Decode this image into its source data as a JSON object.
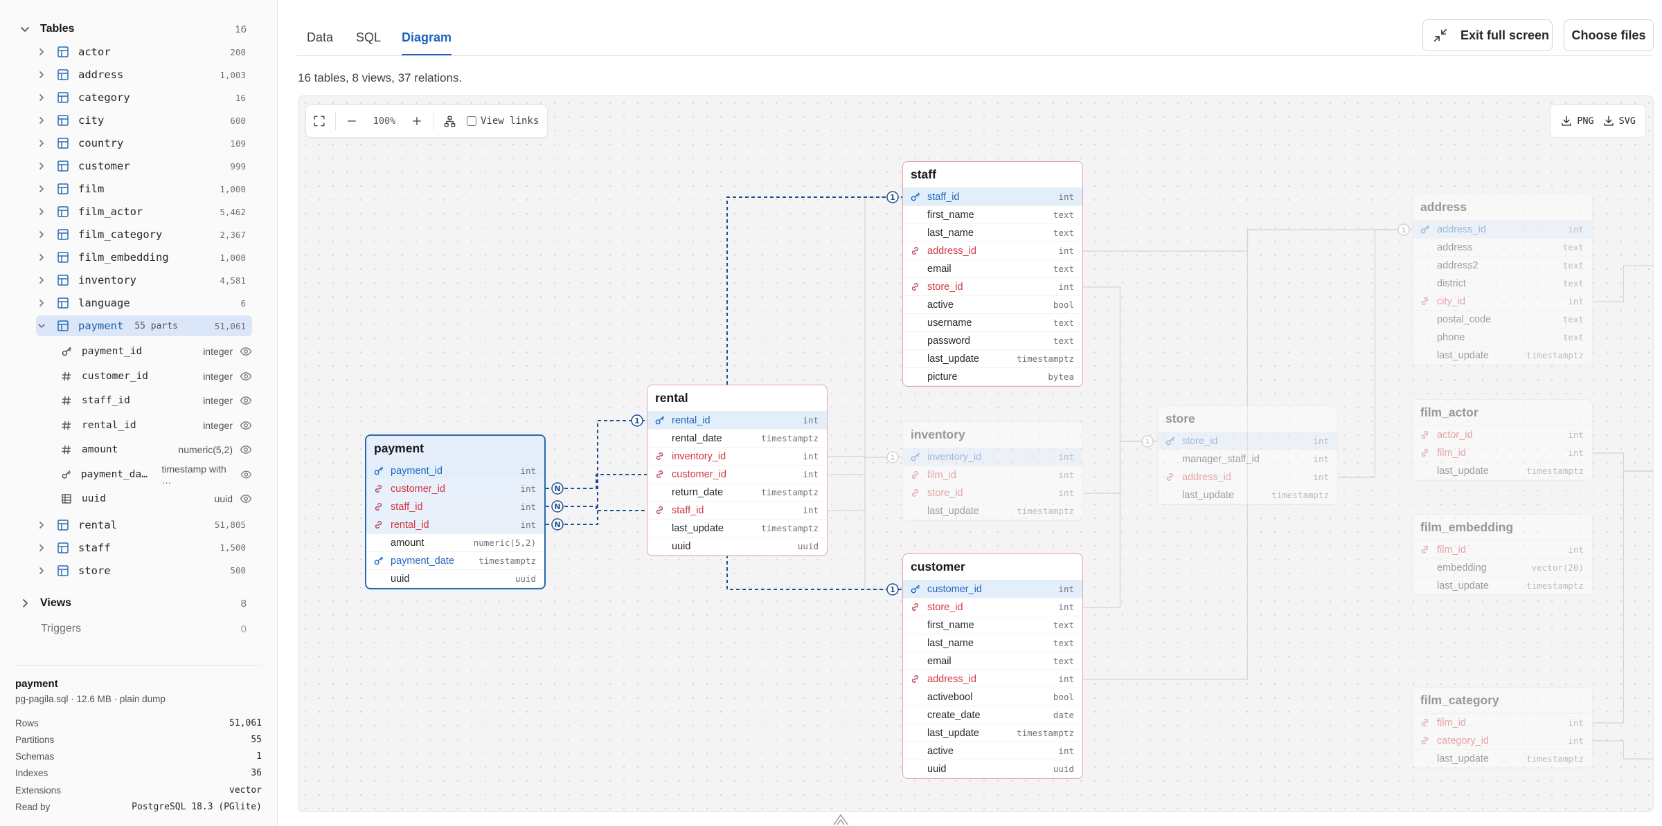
{
  "sidebar": {
    "tables_header": {
      "label": "Tables",
      "count": "16"
    },
    "tables": [
      {
        "name": "actor",
        "count": "200"
      },
      {
        "name": "address",
        "count": "1,003"
      },
      {
        "name": "category",
        "count": "16"
      },
      {
        "name": "city",
        "count": "600"
      },
      {
        "name": "country",
        "count": "109"
      },
      {
        "name": "customer",
        "count": "999"
      },
      {
        "name": "film",
        "count": "1,000"
      },
      {
        "name": "film_actor",
        "count": "5,462"
      },
      {
        "name": "film_category",
        "count": "2,367"
      },
      {
        "name": "film_embedding",
        "count": "1,000"
      },
      {
        "name": "inventory",
        "count": "4,581"
      },
      {
        "name": "language",
        "count": "6"
      },
      {
        "name": "payment",
        "parts": "55 parts",
        "count": "51,061"
      },
      {
        "name": "rental",
        "count": "51,805"
      },
      {
        "name": "staff",
        "count": "1,500"
      },
      {
        "name": "store",
        "count": "500"
      }
    ],
    "payment_columns": [
      {
        "name": "payment_id",
        "type": "integer",
        "icon": "key-icon"
      },
      {
        "name": "customer_id",
        "type": "integer",
        "icon": "hash-icon"
      },
      {
        "name": "staff_id",
        "type": "integer",
        "icon": "hash-icon"
      },
      {
        "name": "rental_id",
        "type": "integer",
        "icon": "hash-icon"
      },
      {
        "name": "amount",
        "type": "numeric(5,2)",
        "icon": "hash-icon"
      },
      {
        "name": "payment_da…",
        "type": "timestamp with …",
        "icon": "key-icon"
      },
      {
        "name": "uuid",
        "type": "uuid",
        "icon": "grid-icon"
      }
    ],
    "views_header": {
      "label": "Views",
      "count": "8"
    },
    "triggers_header": {
      "label": "Triggers",
      "count": "0"
    },
    "info": {
      "title": "payment",
      "subtitle": "pg-pagila.sql · 12.6 MB · plain dump",
      "stats": [
        {
          "label": "Rows",
          "value": "51,061"
        },
        {
          "label": "Partitions",
          "value": "55"
        },
        {
          "label": "Schemas",
          "value": "1"
        },
        {
          "label": "Indexes",
          "value": "36"
        },
        {
          "label": "Extensions",
          "value": "vector"
        },
        {
          "label": "Read by",
          "value": "PostgreSQL 18.3 (PGlite)"
        }
      ]
    }
  },
  "tabs": [
    "Data",
    "SQL",
    "Diagram"
  ],
  "active_tab": "Diagram",
  "buttons": {
    "exit_fullscreen": "Exit full screen",
    "choose_files": "Choose files"
  },
  "summary": "16 tables, 8 views, 37 relations.",
  "toolbar": {
    "zoom": "100%",
    "view_links": "View links",
    "png": "PNG",
    "svg": "SVG"
  },
  "colors": {
    "accent": "#1d63b8",
    "fk": "#d2353f",
    "entity_border": "#e3a3ad"
  },
  "entities": {
    "payment": {
      "title": "payment",
      "rows": [
        {
          "name": "payment_id",
          "type": "int"
        },
        {
          "name": "customer_id",
          "type": "int"
        },
        {
          "name": "staff_id",
          "type": "int"
        },
        {
          "name": "rental_id",
          "type": "int"
        },
        {
          "name": "amount",
          "type": "numeric(5,2)"
        },
        {
          "name": "payment_date",
          "type": "timestamptz"
        },
        {
          "name": "uuid",
          "type": "uuid"
        }
      ]
    },
    "rental": {
      "title": "rental",
      "rows": [
        {
          "name": "rental_id",
          "type": "int"
        },
        {
          "name": "rental_date",
          "type": "timestamptz"
        },
        {
          "name": "inventory_id",
          "type": "int"
        },
        {
          "name": "customer_id",
          "type": "int"
        },
        {
          "name": "return_date",
          "type": "timestamptz"
        },
        {
          "name": "staff_id",
          "type": "int"
        },
        {
          "name": "last_update",
          "type": "timestamptz"
        },
        {
          "name": "uuid",
          "type": "uuid"
        }
      ]
    },
    "staff": {
      "title": "staff",
      "rows": [
        {
          "name": "staff_id",
          "type": "int"
        },
        {
          "name": "first_name",
          "type": "text"
        },
        {
          "name": "last_name",
          "type": "text"
        },
        {
          "name": "address_id",
          "type": "int"
        },
        {
          "name": "email",
          "type": "text"
        },
        {
          "name": "store_id",
          "type": "int"
        },
        {
          "name": "active",
          "type": "bool"
        },
        {
          "name": "username",
          "type": "text"
        },
        {
          "name": "password",
          "type": "text"
        },
        {
          "name": "last_update",
          "type": "timestamptz"
        },
        {
          "name": "picture",
          "type": "bytea"
        }
      ]
    },
    "inventory": {
      "title": "inventory",
      "rows": [
        {
          "name": "inventory_id",
          "type": "int"
        },
        {
          "name": "film_id",
          "type": "int"
        },
        {
          "name": "store_id",
          "type": "int"
        },
        {
          "name": "last_update",
          "type": "timestamptz"
        }
      ]
    },
    "customer": {
      "title": "customer",
      "rows": [
        {
          "name": "customer_id",
          "type": "int"
        },
        {
          "name": "store_id",
          "type": "int"
        },
        {
          "name": "first_name",
          "type": "text"
        },
        {
          "name": "last_name",
          "type": "text"
        },
        {
          "name": "email",
          "type": "text"
        },
        {
          "name": "address_id",
          "type": "int"
        },
        {
          "name": "activebool",
          "type": "bool"
        },
        {
          "name": "create_date",
          "type": "date"
        },
        {
          "name": "last_update",
          "type": "timestamptz"
        },
        {
          "name": "active",
          "type": "int"
        },
        {
          "name": "uuid",
          "type": "uuid"
        }
      ]
    },
    "store": {
      "title": "store",
      "rows": [
        {
          "name": "store_id",
          "type": "int"
        },
        {
          "name": "manager_staff_id",
          "type": "int"
        },
        {
          "name": "address_id",
          "type": "int"
        },
        {
          "name": "last_update",
          "type": "timestamptz"
        }
      ]
    },
    "address": {
      "title": "address",
      "rows": [
        {
          "name": "address_id",
          "type": "int"
        },
        {
          "name": "address",
          "type": "text"
        },
        {
          "name": "address2",
          "type": "text"
        },
        {
          "name": "district",
          "type": "text"
        },
        {
          "name": "city_id",
          "type": "int"
        },
        {
          "name": "postal_code",
          "type": "text"
        },
        {
          "name": "phone",
          "type": "text"
        },
        {
          "name": "last_update",
          "type": "timestamptz"
        }
      ]
    },
    "film_actor": {
      "title": "film_actor",
      "rows": [
        {
          "name": "actor_id",
          "type": "int"
        },
        {
          "name": "film_id",
          "type": "int"
        },
        {
          "name": "last_update",
          "type": "timestamptz"
        }
      ]
    },
    "film_embedding": {
      "title": "film_embedding",
      "rows": [
        {
          "name": "film_id",
          "type": "int"
        },
        {
          "name": "embedding",
          "type": "vector(20)"
        },
        {
          "name": "last_update",
          "type": "timestamptz"
        }
      ]
    },
    "film_category": {
      "title": "film_category",
      "rows": [
        {
          "name": "film_id",
          "type": "int"
        },
        {
          "name": "category_id",
          "type": "int"
        },
        {
          "name": "last_update",
          "type": "timestamptz"
        }
      ]
    }
  },
  "cardinality": {
    "one": "1",
    "many": "N"
  }
}
